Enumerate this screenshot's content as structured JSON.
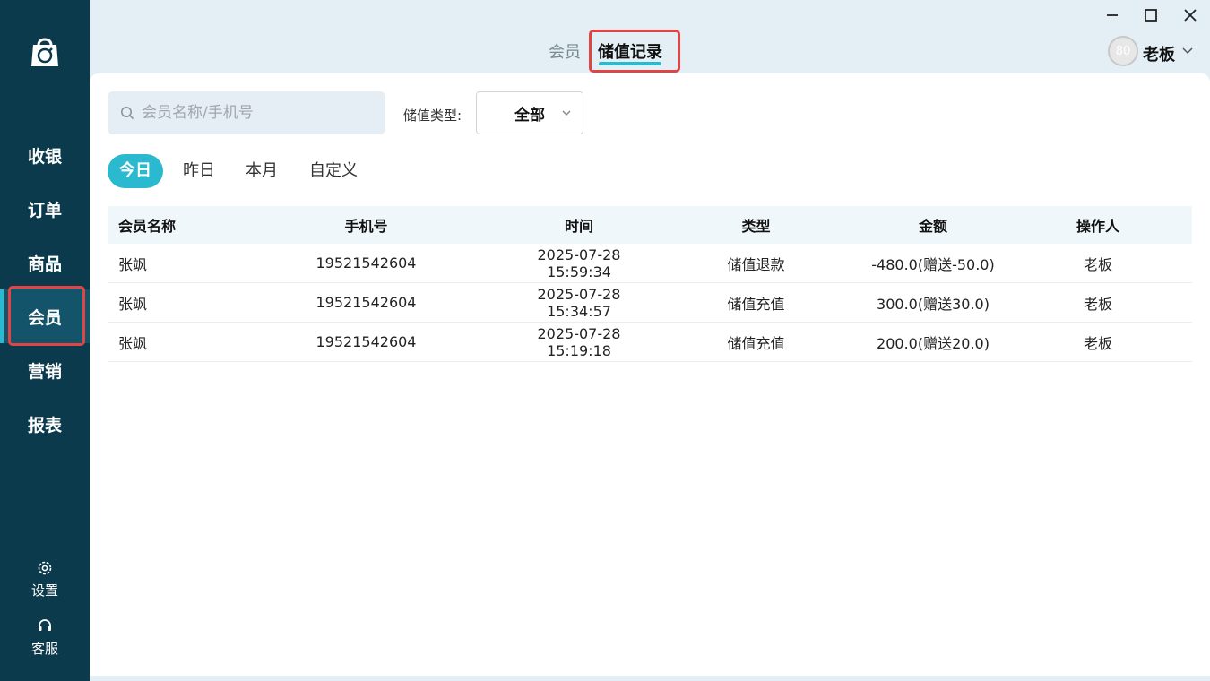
{
  "window": {
    "buttons": [
      "minimize",
      "maximize",
      "close"
    ]
  },
  "sidebar": {
    "items": [
      {
        "label": "收银"
      },
      {
        "label": "订单"
      },
      {
        "label": "商品"
      },
      {
        "label": "会员",
        "active": true
      },
      {
        "label": "营销"
      },
      {
        "label": "报表"
      }
    ],
    "settings_label": "设置",
    "service_label": "客服"
  },
  "header": {
    "tabs": [
      {
        "label": "会员"
      },
      {
        "label": "储值记录",
        "active": true
      }
    ],
    "user": {
      "avatar_text": "80",
      "name": "老板"
    }
  },
  "filters": {
    "search_placeholder": "会员名称/手机号",
    "type_label": "储值类型:",
    "type_value": "全部",
    "date_tabs": [
      {
        "label": "今日",
        "active": true
      },
      {
        "label": "昨日"
      },
      {
        "label": "本月"
      },
      {
        "label": "自定义"
      }
    ]
  },
  "table": {
    "columns": [
      "会员名称",
      "手机号",
      "时间",
      "类型",
      "金额",
      "操作人"
    ],
    "rows": [
      [
        "张飒",
        "19521542604",
        "2025-07-28 15:59:34",
        "储值退款",
        "-480.0(赠送-50.0)",
        "老板"
      ],
      [
        "张飒",
        "19521542604",
        "2025-07-28 15:34:57",
        "储值充值",
        "300.0(赠送30.0)",
        "老板"
      ],
      [
        "张飒",
        "19521542604",
        "2025-07-28 15:19:18",
        "储值充值",
        "200.0(赠送20.0)",
        "老板"
      ]
    ]
  },
  "colors": {
    "sidebar_bg": "#0b3a4d",
    "accent": "#2bb9cf",
    "highlight": "#e04545"
  }
}
